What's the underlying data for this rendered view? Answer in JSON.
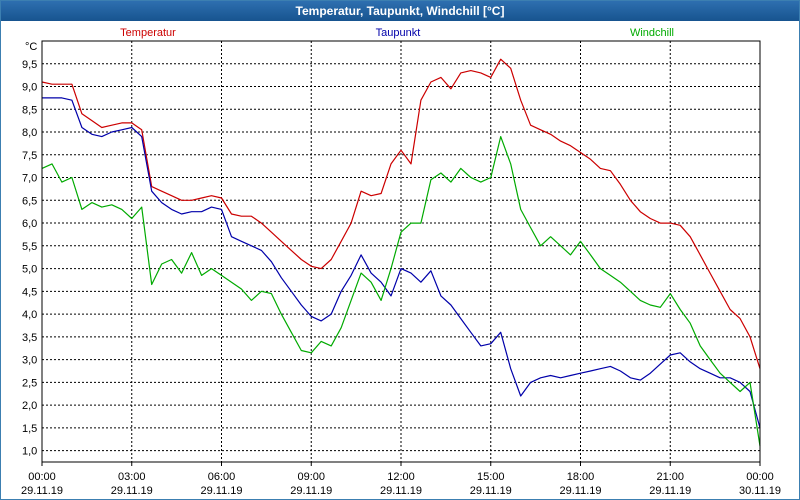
{
  "window": {
    "title": "Temperatur, Taupunkt, Windchill [°C]"
  },
  "chart_data": {
    "type": "line",
    "title": "Temperatur, Taupunkt, Windchill [°C]",
    "ylabel": "°C",
    "ylim": [
      0.75,
      10.0
    ],
    "yticks": [
      1.0,
      1.5,
      2.0,
      2.5,
      3.0,
      3.5,
      4.0,
      4.5,
      5.0,
      5.5,
      6.0,
      6.5,
      7.0,
      7.5,
      8.0,
      8.5,
      9.0,
      9.5
    ],
    "ytick_labels": [
      "1,0",
      "1,5",
      "2,0",
      "2,5",
      "3,0",
      "3,5",
      "4,0",
      "4,5",
      "5,0",
      "5,5",
      "6,0",
      "6,5",
      "7,0",
      "7,5",
      "8,0",
      "8,5",
      "9,0",
      "9,5"
    ],
    "xlim": [
      "29.11.19 00:00",
      "30.11.19 00:00"
    ],
    "xticks": [
      {
        "time": "00:00",
        "date": "29.11.19"
      },
      {
        "time": "03:00",
        "date": "29.11.19"
      },
      {
        "time": "06:00",
        "date": "29.11.19"
      },
      {
        "time": "09:00",
        "date": "29.11.19"
      },
      {
        "time": "12:00",
        "date": "29.11.19"
      },
      {
        "time": "15:00",
        "date": "29.11.19"
      },
      {
        "time": "18:00",
        "date": "29.11.19"
      },
      {
        "time": "21:00",
        "date": "29.11.19"
      },
      {
        "time": "00:00",
        "date": "30.11.19"
      }
    ],
    "grid": true,
    "legend_position": "top",
    "series": [
      {
        "name": "Temperatur",
        "color": "#cc0000",
        "x": [
          "00:00",
          "00:20",
          "00:40",
          "01:00",
          "01:20",
          "01:40",
          "02:00",
          "02:20",
          "02:40",
          "03:00",
          "03:20",
          "03:40",
          "04:00",
          "04:20",
          "04:40",
          "05:00",
          "05:20",
          "05:40",
          "06:00",
          "06:20",
          "06:40",
          "07:00",
          "07:20",
          "07:40",
          "08:00",
          "08:20",
          "08:40",
          "09:00",
          "09:20",
          "09:40",
          "10:00",
          "10:20",
          "10:40",
          "11:00",
          "11:20",
          "11:40",
          "12:00",
          "12:20",
          "12:40",
          "13:00",
          "13:20",
          "13:40",
          "14:00",
          "14:20",
          "14:40",
          "15:00",
          "15:20",
          "15:40",
          "16:00",
          "16:20",
          "16:40",
          "17:00",
          "17:20",
          "17:40",
          "18:00",
          "18:20",
          "18:40",
          "19:00",
          "19:20",
          "19:40",
          "20:00",
          "20:20",
          "20:40",
          "21:00",
          "21:20",
          "21:40",
          "22:00",
          "22:20",
          "22:40",
          "23:00",
          "23:20",
          "23:40",
          "24:00"
        ],
        "y": [
          9.1,
          9.05,
          9.05,
          9.05,
          8.4,
          8.25,
          8.1,
          8.15,
          8.2,
          8.2,
          8.05,
          6.8,
          6.7,
          6.6,
          6.5,
          6.5,
          6.55,
          6.6,
          6.55,
          6.2,
          6.15,
          6.15,
          6.0,
          5.8,
          5.6,
          5.4,
          5.2,
          5.05,
          5.0,
          5.2,
          5.6,
          6.0,
          6.7,
          6.6,
          6.65,
          7.3,
          7.6,
          7.3,
          8.7,
          9.1,
          9.2,
          8.95,
          9.3,
          9.35,
          9.3,
          9.2,
          9.6,
          9.4,
          8.7,
          8.15,
          8.05,
          7.95,
          7.8,
          7.7,
          7.55,
          7.4,
          7.2,
          7.15,
          6.85,
          6.5,
          6.25,
          6.1,
          6.0,
          6.0,
          5.95,
          5.7,
          5.3,
          4.9,
          4.5,
          4.1,
          3.9,
          3.5,
          2.8
        ]
      },
      {
        "name": "Taupunkt",
        "color": "#0000aa",
        "x": [
          "00:00",
          "00:20",
          "00:40",
          "01:00",
          "01:20",
          "01:40",
          "02:00",
          "02:20",
          "02:40",
          "03:00",
          "03:20",
          "03:40",
          "04:00",
          "04:20",
          "04:40",
          "05:00",
          "05:20",
          "05:40",
          "06:00",
          "06:20",
          "06:40",
          "07:00",
          "07:20",
          "07:40",
          "08:00",
          "08:20",
          "08:40",
          "09:00",
          "09:20",
          "09:40",
          "10:00",
          "10:20",
          "10:40",
          "11:00",
          "11:20",
          "11:40",
          "12:00",
          "12:20",
          "12:40",
          "13:00",
          "13:20",
          "13:40",
          "14:00",
          "14:20",
          "14:40",
          "15:00",
          "15:20",
          "15:40",
          "16:00",
          "16:20",
          "16:40",
          "17:00",
          "17:20",
          "17:40",
          "18:00",
          "18:20",
          "18:40",
          "19:00",
          "19:20",
          "19:40",
          "20:00",
          "20:20",
          "20:40",
          "21:00",
          "21:20",
          "21:40",
          "22:00",
          "22:20",
          "22:40",
          "23:00",
          "23:20",
          "23:40",
          "24:00"
        ],
        "y": [
          8.75,
          8.75,
          8.75,
          8.7,
          8.1,
          7.95,
          7.9,
          8.0,
          8.05,
          8.1,
          7.9,
          6.7,
          6.45,
          6.3,
          6.2,
          6.25,
          6.25,
          6.35,
          6.3,
          5.7,
          5.6,
          5.5,
          5.4,
          5.15,
          4.8,
          4.5,
          4.2,
          3.95,
          3.85,
          4.0,
          4.5,
          4.85,
          5.3,
          4.9,
          4.7,
          4.4,
          5.0,
          4.9,
          4.7,
          4.95,
          4.4,
          4.2,
          3.9,
          3.6,
          3.3,
          3.35,
          3.6,
          2.8,
          2.2,
          2.5,
          2.6,
          2.65,
          2.6,
          2.65,
          2.7,
          2.75,
          2.8,
          2.85,
          2.75,
          2.6,
          2.55,
          2.7,
          2.9,
          3.1,
          3.15,
          2.95,
          2.8,
          2.7,
          2.6,
          2.6,
          2.5,
          2.3,
          1.5
        ]
      },
      {
        "name": "Windchill",
        "color": "#00aa00",
        "x": [
          "00:00",
          "00:20",
          "00:40",
          "01:00",
          "01:20",
          "01:40",
          "02:00",
          "02:20",
          "02:40",
          "03:00",
          "03:20",
          "03:40",
          "04:00",
          "04:20",
          "04:40",
          "05:00",
          "05:20",
          "05:40",
          "06:00",
          "06:20",
          "06:40",
          "07:00",
          "07:20",
          "07:40",
          "08:00",
          "08:20",
          "08:40",
          "09:00",
          "09:20",
          "09:40",
          "10:00",
          "10:20",
          "10:40",
          "11:00",
          "11:20",
          "11:40",
          "12:00",
          "12:20",
          "12:40",
          "13:00",
          "13:20",
          "13:40",
          "14:00",
          "14:20",
          "14:40",
          "15:00",
          "15:20",
          "15:40",
          "16:00",
          "16:20",
          "16:40",
          "17:00",
          "17:20",
          "17:40",
          "18:00",
          "18:20",
          "18:40",
          "19:00",
          "19:20",
          "19:40",
          "20:00",
          "20:20",
          "20:40",
          "21:00",
          "21:20",
          "21:40",
          "22:00",
          "22:20",
          "22:40",
          "23:00",
          "23:20",
          "23:40",
          "24:00"
        ],
        "y": [
          7.2,
          7.3,
          6.9,
          7.0,
          6.3,
          6.45,
          6.35,
          6.4,
          6.3,
          6.1,
          6.35,
          4.65,
          5.1,
          5.2,
          4.9,
          5.35,
          4.85,
          5.0,
          4.85,
          4.7,
          4.55,
          4.3,
          4.5,
          4.45,
          4.0,
          3.6,
          3.2,
          3.15,
          3.4,
          3.3,
          3.7,
          4.3,
          4.9,
          4.7,
          4.3,
          5.0,
          5.8,
          6.0,
          6.0,
          6.95,
          7.1,
          6.9,
          7.2,
          7.0,
          6.9,
          7.0,
          7.9,
          7.3,
          6.3,
          5.9,
          5.5,
          5.7,
          5.5,
          5.3,
          5.6,
          5.3,
          5.0,
          4.85,
          4.7,
          4.5,
          4.3,
          4.2,
          4.15,
          4.45,
          4.1,
          3.8,
          3.3,
          3.0,
          2.7,
          2.5,
          2.3,
          2.5,
          1.1
        ]
      }
    ]
  }
}
